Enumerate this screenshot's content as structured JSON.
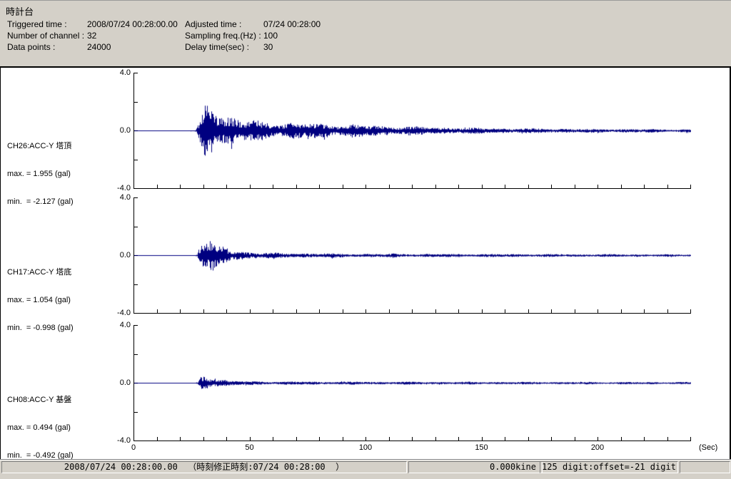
{
  "colors": {
    "trace": "#000080",
    "header_bg": "#d4d0c8",
    "plot_bg": "#ffffff",
    "axis": "#000000"
  },
  "header": {
    "title": "時計台",
    "fields": [
      {
        "label": "Triggered time :",
        "value": "2008/07/24 00:28:00.00"
      },
      {
        "label": "Adjusted time :",
        "value": "07/24 00:28:00"
      },
      {
        "label": "Number of channel :",
        "value": "32"
      },
      {
        "label": "Sampling freq.(Hz) :",
        "value": "100"
      },
      {
        "label": "Data points :",
        "value": "24000"
      },
      {
        "label": "Delay time(sec) :",
        "value": "30"
      }
    ]
  },
  "status_bar": {
    "time_text": "2008/07/24 00:28:00.00  （時刻修正時刻:07/24 00:28:00  ）",
    "kine_text": "0.000kine",
    "digit_text": "125 digit:offset=-21 digit",
    "extra_text": ""
  },
  "chart_data": {
    "type": "line",
    "title": "",
    "x_axis": {
      "min": 0,
      "max": 240,
      "tick_step": 10,
      "labeled_ticks": [
        0,
        50,
        100,
        150,
        200
      ],
      "unit_label": "(Sec)"
    },
    "y_axis": {
      "min": -4.0,
      "max": 4.0,
      "tick_step": 2.0,
      "unit": "gal",
      "labeled_ticks": [
        {
          "value": 4,
          "label": "4.0"
        },
        {
          "value": 0,
          "label": "0.0"
        },
        {
          "value": -4,
          "label": "-4.0"
        }
      ]
    },
    "series": [
      {
        "name": "CH26:ACC-Y 塔頂",
        "max_label": "max. = 1.955 (gal)",
        "min_label": "min.  = -2.127 (gal)",
        "max_gal": 1.955,
        "min_gal": -2.127,
        "seed": 26,
        "envelope": [
          [
            0,
            0.02
          ],
          [
            26,
            0.025
          ],
          [
            27,
            0.15
          ],
          [
            28,
            0.55
          ],
          [
            29.5,
            1.1
          ],
          [
            31,
            1.9
          ],
          [
            33,
            2.05
          ],
          [
            34.5,
            1.5
          ],
          [
            36,
            1.2
          ],
          [
            39,
            0.95
          ],
          [
            43,
            0.8
          ],
          [
            48,
            0.65
          ],
          [
            55,
            0.55
          ],
          [
            65,
            0.5
          ],
          [
            75,
            0.45
          ],
          [
            85,
            0.42
          ],
          [
            95,
            0.38
          ],
          [
            105,
            0.32
          ],
          [
            115,
            0.28
          ],
          [
            130,
            0.22
          ],
          [
            145,
            0.18
          ],
          [
            160,
            0.15
          ],
          [
            180,
            0.13
          ],
          [
            200,
            0.11
          ],
          [
            220,
            0.1
          ],
          [
            240,
            0.09
          ]
        ]
      },
      {
        "name": "CH17:ACC-Y 塔底",
        "max_label": "max. = 1.054 (gal)",
        "min_label": "min.  = -0.998 (gal)",
        "max_gal": 1.054,
        "min_gal": -0.998,
        "seed": 17,
        "envelope": [
          [
            0,
            0.012
          ],
          [
            26,
            0.015
          ],
          [
            27,
            0.1
          ],
          [
            28,
            0.6
          ],
          [
            29,
            0.95
          ],
          [
            30.5,
            1.0
          ],
          [
            32,
            0.75
          ],
          [
            33.5,
            0.95
          ],
          [
            35,
            0.7
          ],
          [
            37,
            0.5
          ],
          [
            38.5,
            0.65
          ],
          [
            40,
            0.45
          ],
          [
            42,
            0.35
          ],
          [
            45,
            0.3
          ],
          [
            50,
            0.22
          ],
          [
            55,
            0.18
          ],
          [
            60,
            0.16
          ],
          [
            70,
            0.14
          ],
          [
            85,
            0.12
          ],
          [
            100,
            0.11
          ],
          [
            130,
            0.1
          ],
          [
            160,
            0.09
          ],
          [
            200,
            0.08
          ],
          [
            240,
            0.07
          ]
        ]
      },
      {
        "name": "CH08:ACC-Y 基盤",
        "max_label": "max. = 0.494 (gal)",
        "min_label": "min.  = -0.492 (gal)",
        "max_gal": 0.494,
        "min_gal": -0.492,
        "seed": 8,
        "envelope": [
          [
            0,
            0.01
          ],
          [
            26,
            0.012
          ],
          [
            27.5,
            0.08
          ],
          [
            28.5,
            0.4
          ],
          [
            30,
            0.5
          ],
          [
            31.5,
            0.45
          ],
          [
            33,
            0.35
          ],
          [
            35,
            0.3
          ],
          [
            37,
            0.22
          ],
          [
            40,
            0.16
          ],
          [
            44,
            0.13
          ],
          [
            50,
            0.11
          ],
          [
            60,
            0.1
          ],
          [
            80,
            0.09
          ],
          [
            110,
            0.085
          ],
          [
            150,
            0.08
          ],
          [
            200,
            0.07
          ],
          [
            240,
            0.065
          ]
        ]
      }
    ]
  }
}
